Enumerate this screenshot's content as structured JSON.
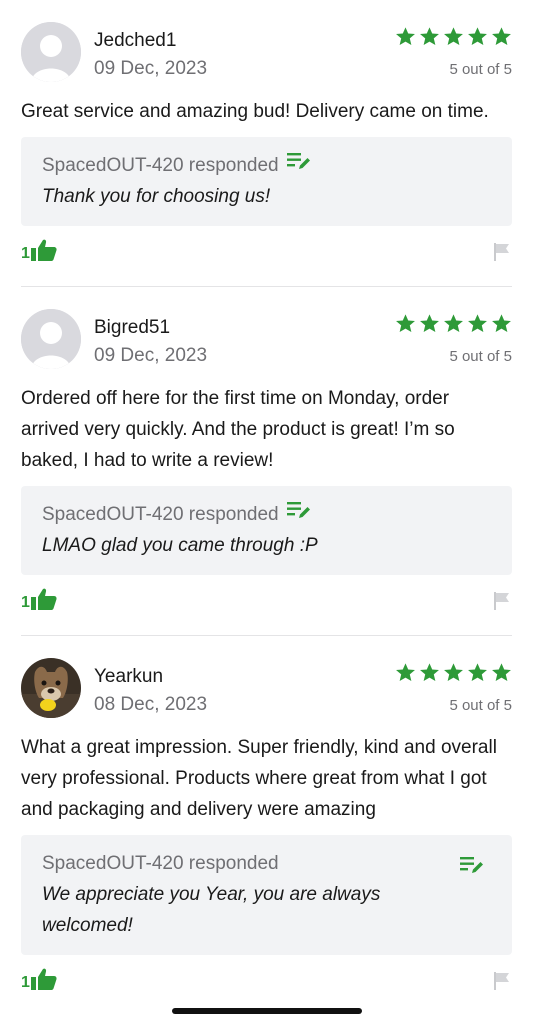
{
  "colors": {
    "accent": "#2e9a38",
    "response_bg": "#f2f3f5",
    "muted": "#6f6f73"
  },
  "reviews": [
    {
      "name": "Jedched1",
      "date": "09 Dec, 2023",
      "rating": 5,
      "rating_text": "5 out of 5",
      "body": "Great service and amazing bud! Delivery came on time.",
      "response": {
        "heading": "SpacedOUT-420 responded",
        "text": "Thank you for choosing us!"
      },
      "likes": "1",
      "avatar": "default-avatar-icon"
    },
    {
      "name": "Bigred51",
      "date": "09 Dec, 2023",
      "rating": 5,
      "rating_text": "5 out of 5",
      "body": "Ordered off here for the first time on Monday, order arrived very quickly. And the product is great! I’m so baked, I had to write a review!",
      "response": {
        "heading": "SpacedOUT-420 responded",
        "text": "LMAO glad you came through :P"
      },
      "likes": "1",
      "avatar": "default-avatar-icon"
    },
    {
      "name": "Yearkun",
      "date": "08 Dec, 2023",
      "rating": 5,
      "rating_text": "5 out of 5",
      "body": "What a great impression. Super friendly, kind and overall very professional. Products where great from what I got and packaging and delivery were amazing",
      "response": {
        "heading": "SpacedOUT-420 responded",
        "text": "We appreciate you Year, you are always welcomed!"
      },
      "likes": "1",
      "avatar": "dog-photo-avatar"
    }
  ]
}
